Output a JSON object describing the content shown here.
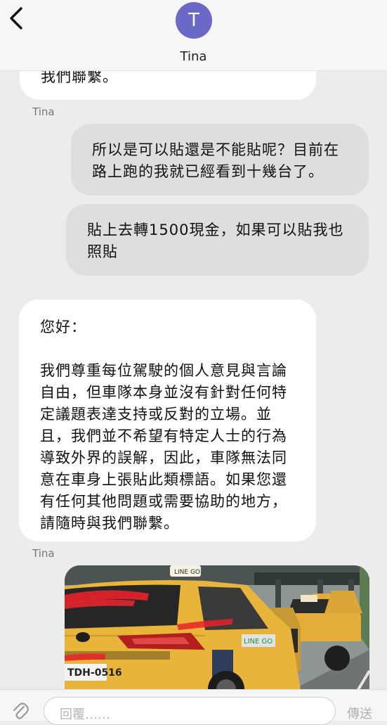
{
  "header": {
    "avatar_initial": "T",
    "contact_name": "Tina"
  },
  "messages": {
    "m1_tail": "我們聯繫。",
    "sender_1": "Tina",
    "m2": "所以是可以貼還是不能貼呢？目前在\n路上跑的我就已經看到十幾台了。",
    "m3": "貼上去轉1500現金，如果可以貼我也\n照貼",
    "m4_greeting": "您好：",
    "m4_body": "我們尊重每位駕駛的個人意見與言論\n自由，但車隊本身並沒有針對任何特\n定議題表達支持或反對的立場。並\n且，我們並不希望有特定人士的行為\n導致外界的誤解，因此，車隊無法同\n意在車身上張貼此類標語。如果您還\n有任何其他問題或需要協助的地方，\n請隨時與我們聯繫。",
    "sender_2": "Tina"
  },
  "photo": {
    "sign_text": "LINE GO",
    "door_text": "LINE GO",
    "plate_text": "TDH-0516"
  },
  "composer": {
    "placeholder": "回覆……",
    "send_label": "傳送"
  },
  "colors": {
    "avatar": "#6b68c8",
    "incoming_bubble": "#ffffff",
    "outgoing_bubble": "#dedede",
    "taxi_yellow": "#e9b43a"
  }
}
